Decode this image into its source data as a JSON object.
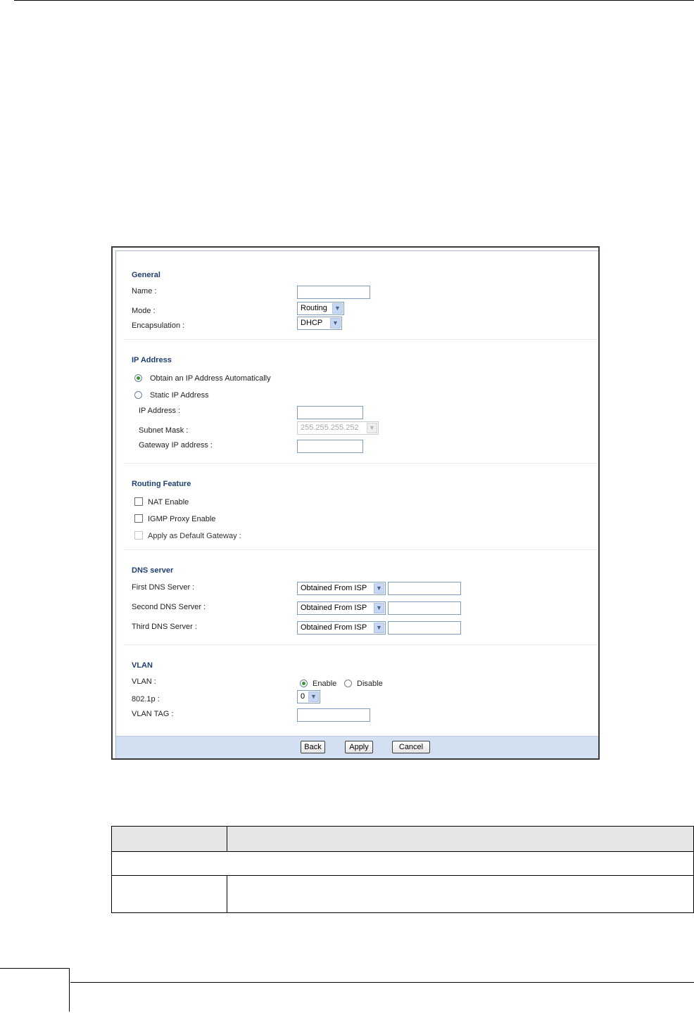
{
  "general": {
    "title": "General",
    "name_label": "Name :",
    "name_value": "",
    "mode_label": "Mode :",
    "mode_value": "Routing",
    "encapsulation_label": "Encapsulation :",
    "encapsulation_value": "DHCP"
  },
  "ip_address": {
    "title": "IP Address",
    "auto_label": "Obtain an IP Address Automatically",
    "static_label": "Static IP Address",
    "ip_label": "IP Address :",
    "ip_value": "",
    "subnet_label": "Subnet Mask :",
    "subnet_value": "255.255.255.252",
    "gateway_label": "Gateway IP address :",
    "gateway_value": ""
  },
  "routing": {
    "title": "Routing Feature",
    "nat_label": "NAT Enable",
    "igmp_label": "IGMP Proxy Enable",
    "default_gw_label": "Apply as Default Gateway :"
  },
  "dns": {
    "title": "DNS server",
    "first_label": "First DNS Server :",
    "second_label": "Second DNS Server :",
    "third_label": "Third DNS Server :",
    "first_value": "Obtained From ISP",
    "second_value": "Obtained From ISP",
    "third_value": "Obtained From ISP"
  },
  "vlan": {
    "title": "VLAN",
    "vlan_label": "VLAN :",
    "enable_label": "Enable",
    "disable_label": "Disable",
    "p8021_label": "802.1p :",
    "p8021_value": "0",
    "tag_label": "VLAN TAG :",
    "tag_value": ""
  },
  "buttons": {
    "back": "Back",
    "apply": "Apply",
    "cancel": "Cancel"
  },
  "icons": {
    "dropdown": "chevron-down-icon"
  },
  "colors": {
    "section_title": "#1f3f6e",
    "button_bar": "#d3e0f1",
    "radio_selected": "#2d9b2d"
  }
}
